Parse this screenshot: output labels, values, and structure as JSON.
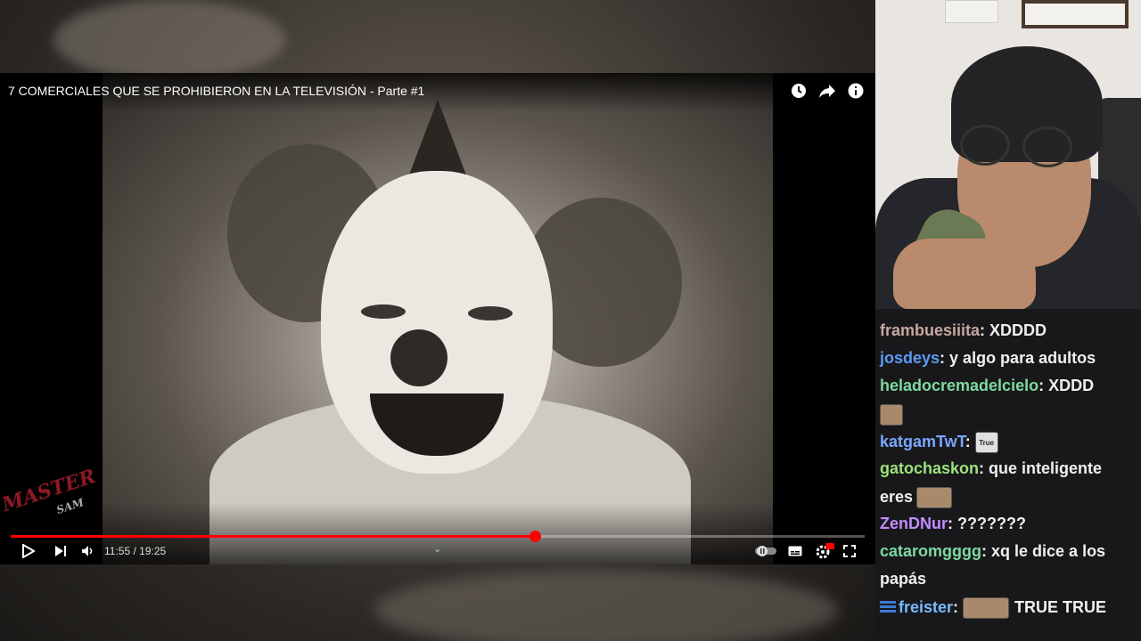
{
  "player": {
    "title": "7 COMERCIALES QUE SE PROHIBIERON EN LA TELEVISIÓN - Parte #1",
    "time_display": "11:55 / 19:25",
    "progress": 0.614,
    "icons": {
      "watch_later": "clock-icon",
      "share": "share-icon",
      "info": "info-icon",
      "play": "play-icon",
      "next": "next-icon",
      "volume": "volume-icon",
      "chapters": "chevron-down-icon",
      "autoplay": "autoplay-toggle-icon",
      "subtitles": "subtitles-icon",
      "settings": "settings-hd-icon",
      "fullscreen": "fullscreen-icon"
    },
    "watermark": {
      "line1": "MASTER",
      "line2": "SAM"
    },
    "accent_color": "#ff0000"
  },
  "chat": {
    "messages": [
      {
        "user": "frambuesiiita",
        "color": "#c8a8a0",
        "text": "XDDDD"
      },
      {
        "user": "josdeys",
        "color": "#5b9bf5",
        "text": "y algo para adultos"
      },
      {
        "user": "heladocremadelcielo",
        "color": "#7ed9a0",
        "text": "XDDD"
      },
      {
        "user": "",
        "color": "#efeff1",
        "text": "",
        "emote_only": true
      },
      {
        "user": "katgamTwT",
        "color": "#7aa6ff",
        "text": "",
        "emote": "True"
      },
      {
        "user": "gatochaskon",
        "color": "#9be37a",
        "text": "que inteligente"
      },
      {
        "user": "",
        "color": "#efeff1",
        "text": "eres"
      },
      {
        "user": "ZenDNur",
        "color": "#c48bff",
        "text": "???????"
      },
      {
        "user": "cataromgggg",
        "color": "#7ed9a0",
        "text": "xq le dice a los"
      },
      {
        "user": "",
        "color": "#efeff1",
        "text": "papás"
      },
      {
        "user": "freister",
        "color": "#7ab8ff",
        "text": "TRUE TRUE"
      }
    ],
    "separator": ":"
  }
}
